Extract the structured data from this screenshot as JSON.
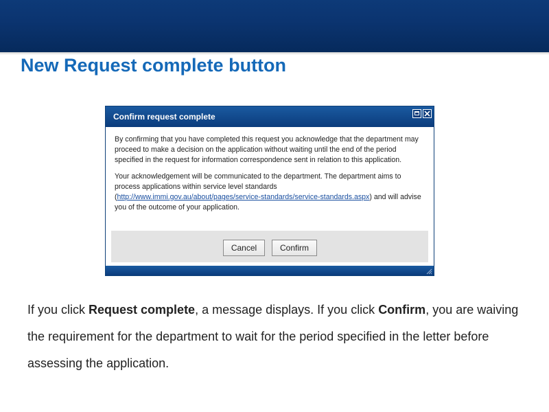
{
  "slide": {
    "title": "New Request complete button"
  },
  "dialog": {
    "title": "Confirm request complete",
    "paragraph1": "By confirming that you have completed this request you acknowledge that the department may proceed to make a decision on the application without waiting until the end of the period specified in the request for information correspondence sent in relation to this application.",
    "paragraph2_before": "Your acknowledgement will be communicated to the department. The department aims to process applications within service level standards (",
    "paragraph2_link": "http://www.immi.gov.au/about/pages/service-standards/service-standards.aspx",
    "paragraph2_after": ") and will advise you of the outcome of your application.",
    "cancel_label": "Cancel",
    "confirm_label": "Confirm"
  },
  "caption": {
    "part1": "If you click ",
    "bold1": "Request complete",
    "part2": ", a message displays. If you click ",
    "bold2": "Confirm",
    "part3": ", you are waiving the requirement for the department to wait for the period specified in the letter before assessing the application."
  },
  "colors": {
    "header_band": "#0b3470",
    "title_text": "#1569b8",
    "dialog_titlebar": "#0b3c7c",
    "button_bar": "#e3e3e3"
  }
}
